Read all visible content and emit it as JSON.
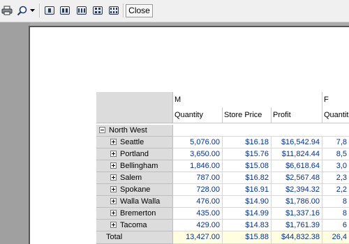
{
  "toolbar": {
    "close_label": "Close"
  },
  "grid": {
    "col_group_1": "M",
    "col_group_2": "F",
    "columns": [
      "Quantity",
      "Store Price",
      "Profit",
      "Quantit"
    ],
    "region": "North West",
    "rows": [
      {
        "label": "Seattle",
        "values": [
          "5,076.00",
          "$16.18",
          "$16,542.94",
          "7,8"
        ]
      },
      {
        "label": "Portland",
        "values": [
          "3,650.00",
          "$15.76",
          "$11,824.44",
          "8,5"
        ]
      },
      {
        "label": "Bellingham",
        "values": [
          "1,846.00",
          "$15.08",
          "$6,618.64",
          "3,0"
        ]
      },
      {
        "label": "Salem",
        "values": [
          "787.00",
          "$16.82",
          "$2,567.48",
          "2,3"
        ]
      },
      {
        "label": "Spokane",
        "values": [
          "728.00",
          "$16.91",
          "$2,394.32",
          "2,2"
        ]
      },
      {
        "label": "Walla Walla",
        "values": [
          "476.00",
          "$14.90",
          "$1,786.00",
          "8"
        ]
      },
      {
        "label": "Bremerton",
        "values": [
          "435.00",
          "$14.99",
          "$1,337.16",
          "8"
        ]
      },
      {
        "label": "Tacoma",
        "values": [
          "429.00",
          "$14.83",
          "$1,761.39",
          "6"
        ]
      }
    ],
    "total": {
      "label": "Total",
      "values": [
        "13,427.00",
        "$15.88",
        "$44,832.38",
        "26,4"
      ]
    }
  },
  "colors": {
    "value_text": "#00309c",
    "total_bg": "#ffffe0",
    "header_bg": "#dcdcdc"
  }
}
